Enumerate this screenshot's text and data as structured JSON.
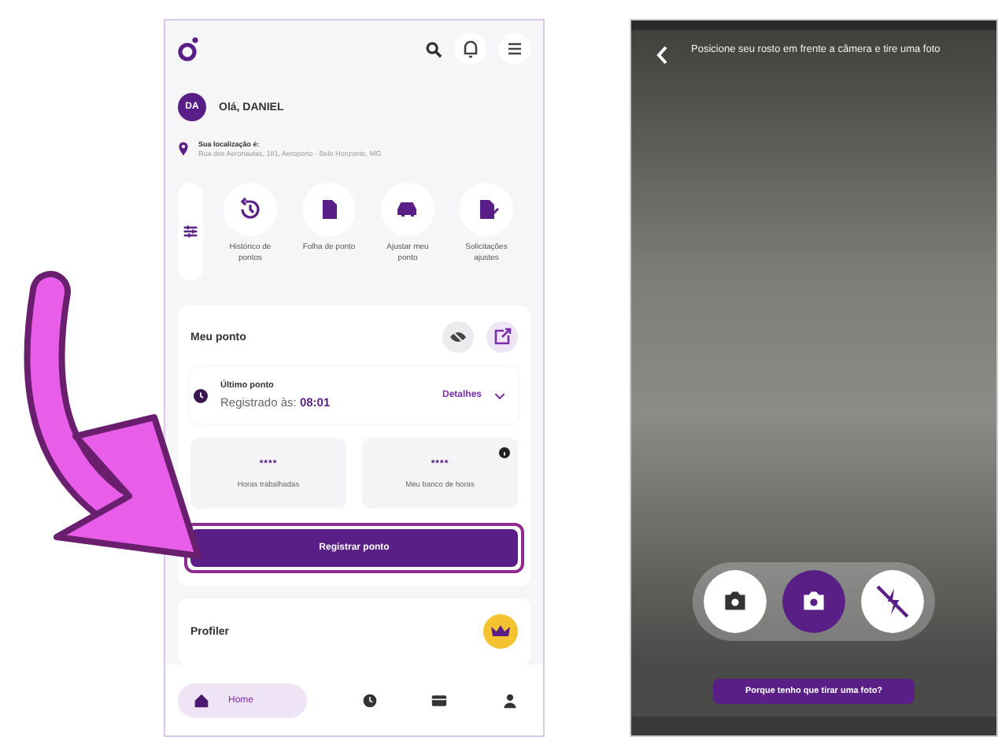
{
  "app_screen": {
    "greeting": {
      "avatar_initials": "DA",
      "text": "Olá, DANIEL"
    },
    "location": {
      "label": "Sua localização é:",
      "address": "Rua dos Aeronautas, 181, Aeroporto - Belo Horizonte, MG"
    },
    "shortcuts": [
      {
        "label": "Histórico de pontos"
      },
      {
        "label": "Folha de ponto"
      },
      {
        "label": "Ajustar meu ponto"
      },
      {
        "label": "Solicitações ajustes"
      }
    ],
    "meu_ponto": {
      "title": "Meu ponto",
      "last_title": "Último ponto",
      "registered_label": "Registrado às:",
      "registered_time": "08:01",
      "details_link": "Detalhes",
      "stats": [
        {
          "value": "****",
          "label": "Horas trabalhadas",
          "info": false
        },
        {
          "value": "****",
          "label": "Meu banco de horas",
          "info": true
        }
      ],
      "register_button": "Registrar ponto",
      "register_highlighted": true
    },
    "profiler": {
      "title": "Profiler"
    },
    "bottom_nav": [
      {
        "label": "Home",
        "selected": true
      },
      {
        "selected": false
      },
      {
        "selected": false
      },
      {
        "selected": false
      }
    ]
  },
  "camera_screen": {
    "instruction": "Posicione seu rosto em frente a câmera e tire uma foto",
    "camera_buttons": [
      {
        "kind": "switch",
        "selected": false
      },
      {
        "kind": "capture",
        "selected": true
      },
      {
        "kind": "flash",
        "selected": false
      }
    ],
    "help_button": "Porque tenho que tirar uma foto?"
  }
}
